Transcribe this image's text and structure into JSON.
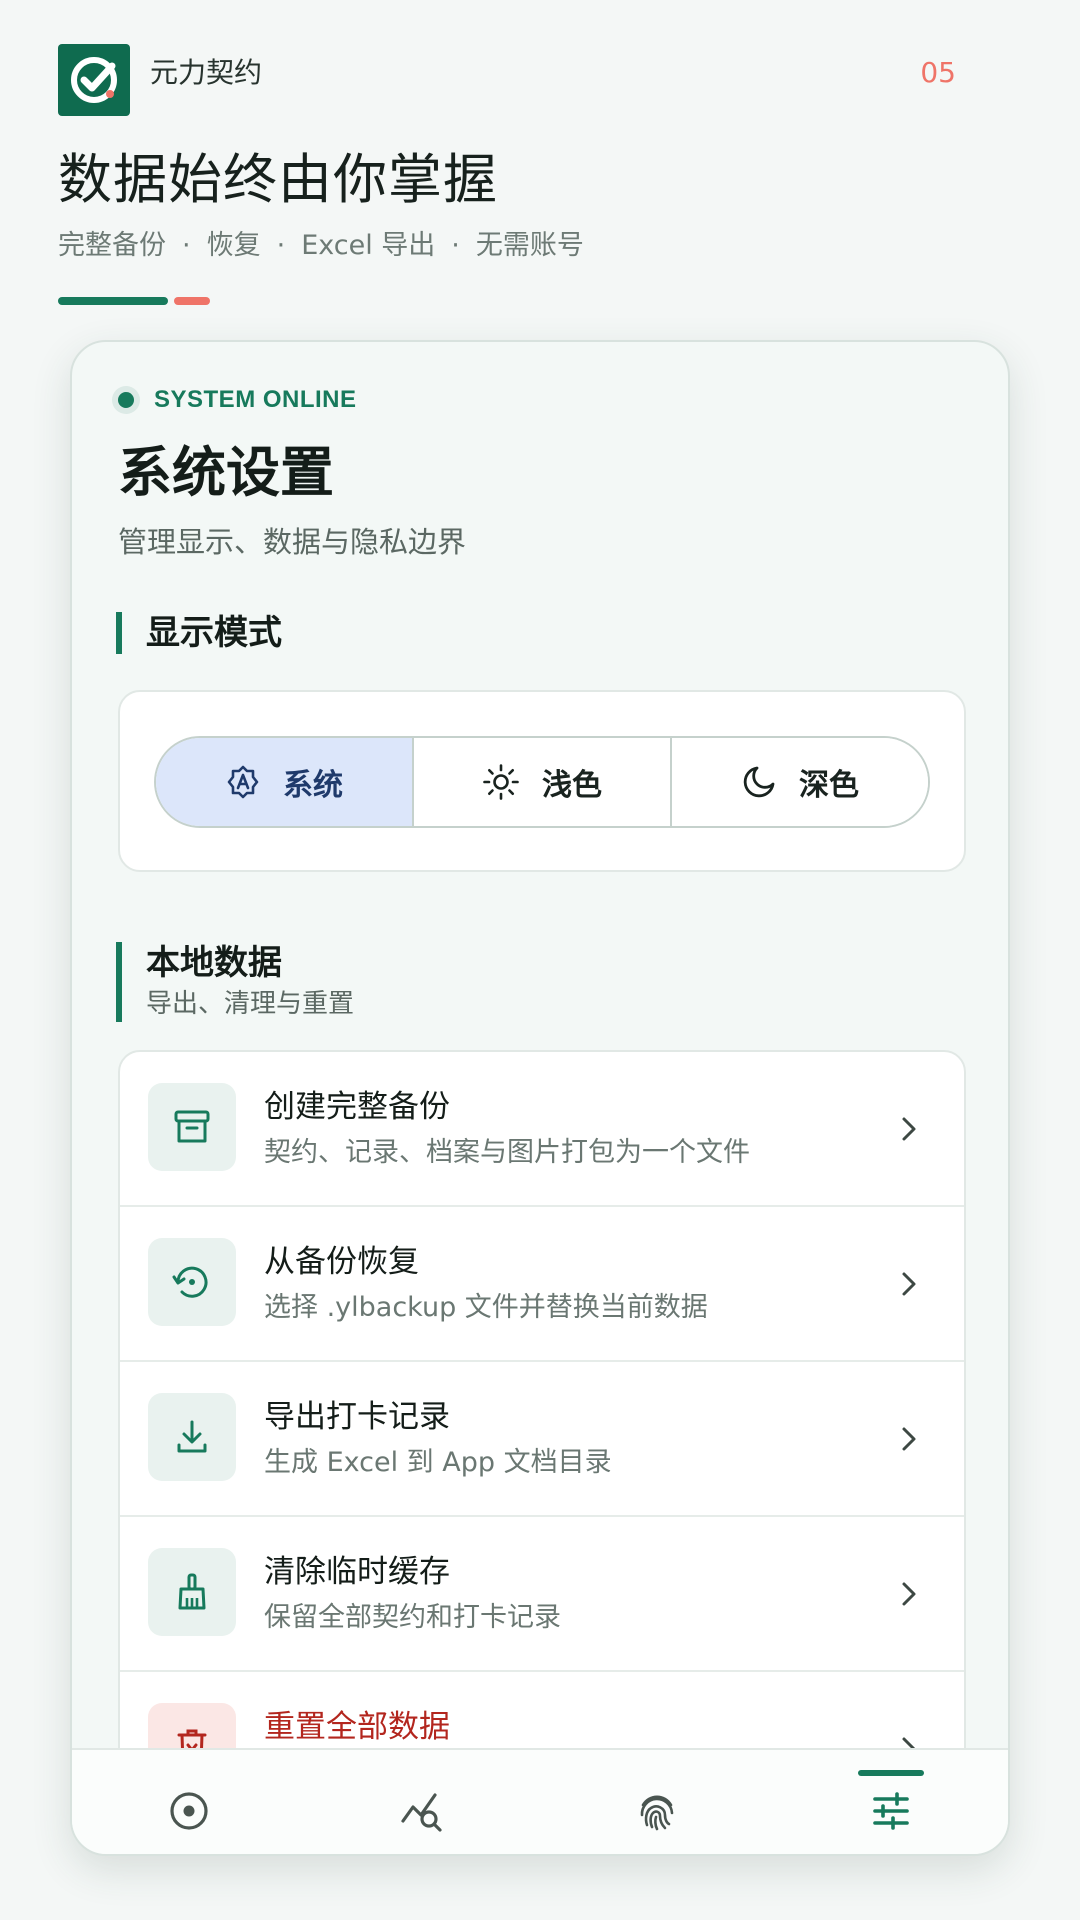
{
  "promo": {
    "app_name": "元力契约",
    "page_number": "05",
    "headline": "数据始终由你掌握",
    "tagline": [
      "完整备份",
      "恢复",
      "Excel 导出",
      "无需账号"
    ],
    "tagline_separator": "·"
  },
  "screen": {
    "status": "SYSTEM ONLINE",
    "title": "系统设置",
    "subtitle": "管理显示、数据与隐私边界",
    "display_section": {
      "title": "显示模式",
      "options": [
        {
          "label": "系统",
          "icon": "auto-theme-icon",
          "selected": true
        },
        {
          "label": "浅色",
          "icon": "sun-icon",
          "selected": false
        },
        {
          "label": "深色",
          "icon": "moon-icon",
          "selected": false
        }
      ]
    },
    "data_section": {
      "title": "本地数据",
      "desc": "导出、清理与重置",
      "items": [
        {
          "title": "创建完整备份",
          "desc": "契约、记录、档案与图片打包为一个文件",
          "icon": "archive-icon"
        },
        {
          "title": "从备份恢复",
          "desc": "选择 .ylbackup 文件并替换当前数据",
          "icon": "restore-icon"
        },
        {
          "title": "导出打卡记录",
          "desc": "生成 Excel 到 App 文档目录",
          "icon": "download-icon"
        },
        {
          "title": "清除临时缓存",
          "desc": "保留全部契约和打卡记录",
          "icon": "broom-icon"
        },
        {
          "title": "重置全部数据",
          "desc": "",
          "icon": "delete-icon",
          "danger": true
        }
      ]
    },
    "bottom_nav": [
      {
        "name": "home-tab",
        "icon": "target-icon",
        "active": false
      },
      {
        "name": "stats-tab",
        "icon": "chart-search-icon",
        "active": false
      },
      {
        "name": "checkin-tab",
        "icon": "fingerprint-icon",
        "active": false
      },
      {
        "name": "settings-tab",
        "icon": "sliders-icon",
        "active": true
      }
    ]
  },
  "colors": {
    "accent": "#177a5c",
    "highlight": "#ef7468",
    "selected_segment": "#dce6fa",
    "danger": "#b3261e"
  }
}
